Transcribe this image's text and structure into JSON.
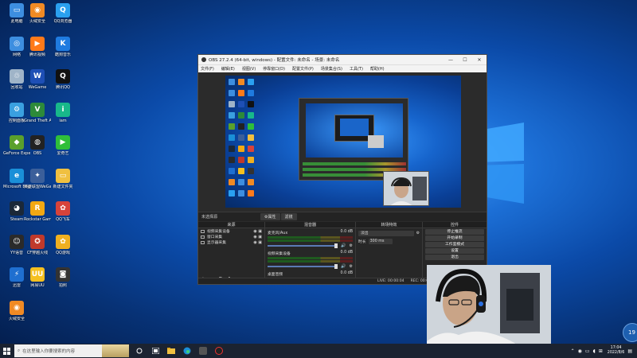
{
  "desktop": {
    "icons": [
      {
        "label": "此电脑",
        "color": "#3d8ee0",
        "glyph": "▭"
      },
      {
        "label": "火绒安全",
        "color": "#f08a24",
        "glyph": "◉"
      },
      {
        "label": "QQ浏览器",
        "color": "#2aa0f0",
        "glyph": "Q"
      },
      {
        "label": "网络",
        "color": "#3d8ee0",
        "glyph": "◎"
      },
      {
        "label": "腾讯视频",
        "color": "#ff7a1a",
        "glyph": "▶"
      },
      {
        "label": "酷狗音乐",
        "color": "#1f7be0",
        "glyph": "K"
      },
      {
        "label": "回收站",
        "color": "#9fb4c8",
        "glyph": "♲"
      },
      {
        "label": "WeGame",
        "color": "#1e4fb5",
        "glyph": "W"
      },
      {
        "label": "腾讯QQ",
        "color": "#111111",
        "glyph": "Q"
      },
      {
        "label": "控制面板",
        "color": "#3aa0e0",
        "glyph": "⚙"
      },
      {
        "label": "Grand Theft Auto V",
        "color": "#2d8a3a",
        "glyph": "V"
      },
      {
        "label": "iam",
        "color": "#18b88a",
        "glyph": "i"
      },
      {
        "label": "GeForce Experience",
        "color": "#5aa02c",
        "glyph": "◆"
      },
      {
        "label": "OBS",
        "color": "#222222",
        "glyph": "◍"
      },
      {
        "label": "爱奇艺",
        "color": "#2fbf3a",
        "glyph": "▶"
      },
      {
        "label": "Microsoft Edge",
        "color": "#1a8fd8",
        "glyph": "e"
      },
      {
        "label": "英雄联盟WeGame版",
        "color": "#3b5f9a",
        "glyph": "✦"
      },
      {
        "label": "新建文件夹",
        "color": "#f0c040",
        "glyph": "▭"
      },
      {
        "label": "Steam",
        "color": "#1b2838",
        "glyph": "◕"
      },
      {
        "label": "Rockstar Games",
        "color": "#f2a812",
        "glyph": "R"
      },
      {
        "label": "QQ飞车",
        "color": "#d8433a",
        "glyph": "✿"
      },
      {
        "label": "YY语音",
        "color": "#2a2a2a",
        "glyph": "☺"
      },
      {
        "label": "CF穿越火线",
        "color": "#c0392b",
        "glyph": "✪"
      },
      {
        "label": "QQ游戏",
        "color": "#f0b020",
        "glyph": "✿"
      },
      {
        "label": "迅雷",
        "color": "#1f6fd0",
        "glyph": "⚡"
      },
      {
        "label": "网易UU",
        "color": "#f5c020",
        "glyph": "UU"
      },
      {
        "label": "拍照",
        "color": "#333333",
        "glyph": "◙"
      },
      {
        "label": "火绒安全",
        "color": "#f08a24",
        "glyph": "◉"
      }
    ]
  },
  "obs": {
    "title": "OBS 27.2.4 (64-bit, windows) - 配置文件: 未命名 - 场景: 未命名",
    "window_controls": [
      "—",
      "☐",
      "✕"
    ],
    "menu": [
      "文件(F)",
      "编辑(E)",
      "视图(V)",
      "停靠窗口(D)",
      "配置文件(P)",
      "场景集合(S)",
      "工具(T)",
      "帮助(H)"
    ],
    "scene_label": "未选择源",
    "scene_tabs": [
      "⚙属性",
      "滤镜"
    ],
    "docks": {
      "sources_title": "来源",
      "mixer_title": "混音器",
      "transitions_title": "转场特效",
      "controls_title": "控件"
    },
    "sources": [
      "视频采集设备",
      "窗口采集",
      "显示器采集"
    ],
    "source_tools": [
      "+",
      "−",
      "⚙",
      "⌃",
      "⌄"
    ],
    "mixer": [
      {
        "name": "麦克风/Aux",
        "db": "0.0 dB"
      },
      {
        "name": "视频采集设备",
        "db": "0.0 dB"
      },
      {
        "name": "桌面音频",
        "db": "0.0 dB"
      }
    ],
    "transitions": {
      "type": "淡出",
      "duration_label": "时长",
      "duration": "300 ms"
    },
    "controls": [
      "停止推流",
      "开始录制",
      "工作室模式",
      "设置",
      "退出"
    ],
    "status": {
      "live": "LIVE: 00:00:04",
      "rec": "REC: 00:00:00",
      "cpu": "CPU: 1.4%, 60.00 fps"
    }
  },
  "taskbar": {
    "search_placeholder": "在这里输入你要搜索的内容",
    "time": "17:04",
    "date": "2022/8/6"
  },
  "bubble_text": "19"
}
